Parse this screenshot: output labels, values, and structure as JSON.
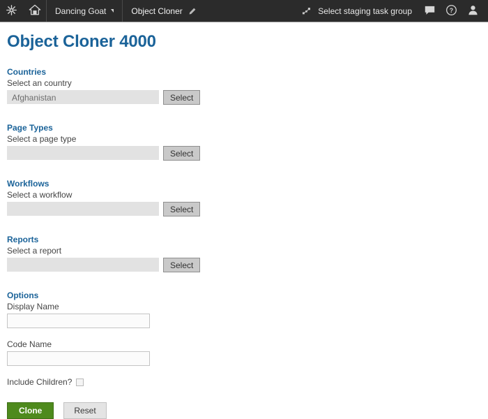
{
  "topbar": {
    "logo_icon": "kentico-starburst-icon",
    "home_icon": "home-icon",
    "breadcrumbs": [
      {
        "label": "Dancing Goat",
        "has_caret": true
      },
      {
        "label": "Object Cloner",
        "has_pencil": true
      }
    ],
    "staging": {
      "label": "Select staging task group",
      "icon": "staging-nodes-icon"
    },
    "icons": [
      {
        "name": "chat-icon"
      },
      {
        "name": "help-icon"
      },
      {
        "name": "user-avatar-icon"
      }
    ]
  },
  "page": {
    "title": "Object Cloner 4000"
  },
  "sections": [
    {
      "heading": "Countries",
      "field_label": "Select an country",
      "value": "Afghanistan",
      "button_label": "Select"
    },
    {
      "heading": "Page Types",
      "field_label": "Select a page type",
      "value": "",
      "button_label": "Select"
    },
    {
      "heading": "Workflows",
      "field_label": "Select a workflow",
      "value": "",
      "button_label": "Select"
    },
    {
      "heading": "Reports",
      "field_label": "Select a report",
      "value": "",
      "button_label": "Select"
    }
  ],
  "options": {
    "heading": "Options",
    "display_name": {
      "label": "Display Name",
      "value": "",
      "placeholder": ""
    },
    "code_name": {
      "label": "Code Name",
      "value": "",
      "placeholder": ""
    },
    "include_children": {
      "label": "Include Children?",
      "checked": false
    }
  },
  "actions": {
    "clone_label": "Clone",
    "reset_label": "Reset"
  },
  "colors": {
    "header_bg": "#2b2b2b",
    "accent_blue": "#1b6399",
    "clone_green": "#4e8a1d",
    "disabled_field": "#e2e2e2",
    "select_button": "#c9c9c9"
  }
}
